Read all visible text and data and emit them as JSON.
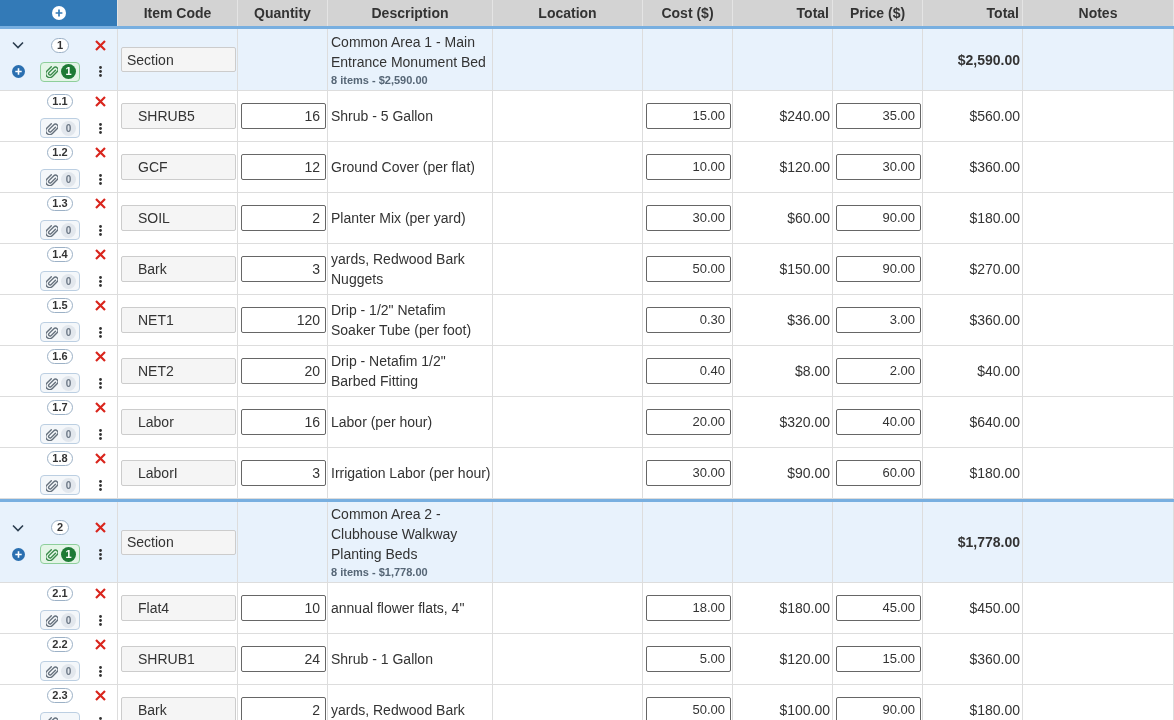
{
  "table": {
    "columns": [
      "Item Code",
      "Quantity",
      "Description",
      "Location",
      "Cost ($)",
      "Total",
      "Price ($)",
      "Total",
      "Notes"
    ],
    "sections": [
      {
        "number": "1",
        "expanded": true,
        "code": "Section",
        "description": "Common Area 1 - Main Entrance Monument Bed",
        "summary": "8 items - $2,590.00",
        "total": "$2,590.00",
        "attachment": {
          "attached": true,
          "count": "1"
        },
        "items": [
          {
            "number": "1.1",
            "code": "SHRUB5",
            "quantity": "16",
            "description": "Shrub - 5 Gallon",
            "cost": "15.00",
            "cost_total": "$240.00",
            "price": "35.00",
            "total": "$560.00",
            "attachment": {
              "attached": false,
              "count": "0"
            }
          },
          {
            "number": "1.2",
            "code": "GCF",
            "quantity": "12",
            "description": "Ground Cover (per flat)",
            "cost": "10.00",
            "cost_total": "$120.00",
            "price": "30.00",
            "total": "$360.00",
            "attachment": {
              "attached": false,
              "count": "0"
            }
          },
          {
            "number": "1.3",
            "code": "SOIL",
            "quantity": "2",
            "description": "Planter Mix (per yard)",
            "cost": "30.00",
            "cost_total": "$60.00",
            "price": "90.00",
            "total": "$180.00",
            "attachment": {
              "attached": false,
              "count": "0"
            }
          },
          {
            "number": "1.4",
            "code": "Bark",
            "quantity": "3",
            "description": "yards, Redwood Bark Nuggets",
            "cost": "50.00",
            "cost_total": "$150.00",
            "price": "90.00",
            "total": "$270.00",
            "attachment": {
              "attached": false,
              "count": "0"
            }
          },
          {
            "number": "1.5",
            "code": "NET1",
            "quantity": "120",
            "description": "Drip - 1/2\" Netafim Soaker Tube (per foot)",
            "cost": "0.30",
            "cost_total": "$36.00",
            "price": "3.00",
            "total": "$360.00",
            "attachment": {
              "attached": false,
              "count": "0"
            }
          },
          {
            "number": "1.6",
            "code": "NET2",
            "quantity": "20",
            "description": "Drip - Netafim 1/2\" Barbed Fitting",
            "cost": "0.40",
            "cost_total": "$8.00",
            "price": "2.00",
            "total": "$40.00",
            "attachment": {
              "attached": false,
              "count": "0"
            }
          },
          {
            "number": "1.7",
            "code": "Labor",
            "quantity": "16",
            "description": "Labor (per hour)",
            "cost": "20.00",
            "cost_total": "$320.00",
            "price": "40.00",
            "total": "$640.00",
            "attachment": {
              "attached": false,
              "count": "0"
            }
          },
          {
            "number": "1.8",
            "code": "LaborI",
            "quantity": "3",
            "description": "Irrigation Labor (per hour)",
            "cost": "30.00",
            "cost_total": "$90.00",
            "price": "60.00",
            "total": "$180.00",
            "attachment": {
              "attached": false,
              "count": "0"
            }
          }
        ]
      },
      {
        "number": "2",
        "expanded": true,
        "code": "Section",
        "description": "Common Area 2 - Clubhouse Walkway Planting Beds",
        "summary": "8 items - $1,778.00",
        "total": "$1,778.00",
        "attachment": {
          "attached": true,
          "count": "1"
        },
        "items": [
          {
            "number": "2.1",
            "code": "Flat4",
            "quantity": "10",
            "description": "annual flower flats, 4\"",
            "cost": "18.00",
            "cost_total": "$180.00",
            "price": "45.00",
            "total": "$450.00",
            "attachment": {
              "attached": false,
              "count": "0"
            }
          },
          {
            "number": "2.2",
            "code": "SHRUB1",
            "quantity": "24",
            "description": "Shrub - 1 Gallon",
            "cost": "5.00",
            "cost_total": "$120.00",
            "price": "15.00",
            "total": "$360.00",
            "attachment": {
              "attached": false,
              "count": "0"
            }
          },
          {
            "number": "2.3",
            "code": "Bark",
            "quantity": "2",
            "description": "yards, Redwood Bark",
            "cost": "50.00",
            "cost_total": "$100.00",
            "price": "90.00",
            "total": "$180.00",
            "attachment": {
              "attached": false
            }
          }
        ]
      }
    ]
  }
}
